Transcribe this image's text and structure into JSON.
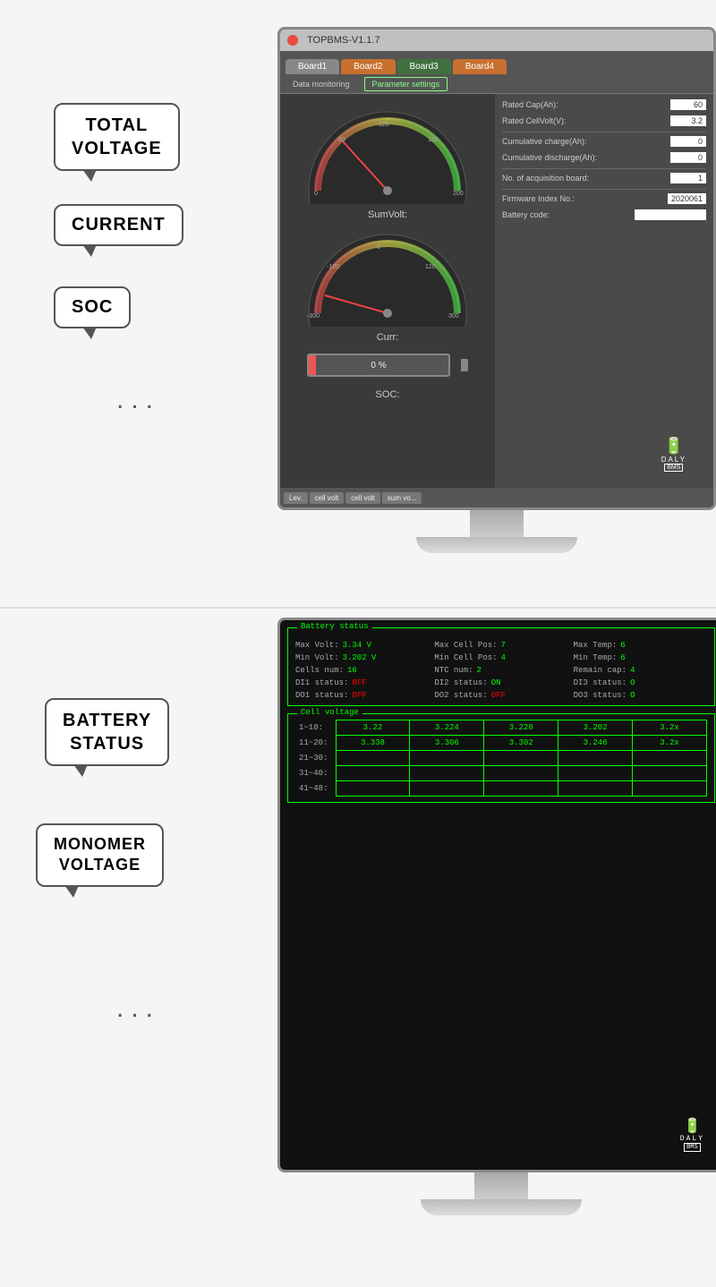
{
  "top_section": {
    "bubble_total_voltage": "TOTAL\nVOLTAGE",
    "bubble_current": "CURRENT",
    "bubble_soc": "SOC",
    "dots": "...",
    "monitor": {
      "title": "TOPBMS-V1.1.7",
      "tabs": [
        "Board1",
        "Board2",
        "Board3",
        "Board4"
      ],
      "subtabs": [
        "Data monitoring",
        "Parameter settings"
      ],
      "gauge1_label": "SumVolt:",
      "gauge2_label": "Curr:",
      "soc_label": "SOC:",
      "battery_percent": "0 %",
      "params": [
        {
          "label": "Rated Cap(Ah):",
          "value": "60"
        },
        {
          "label": "Rated CellVolt(V):",
          "value": "3.2"
        },
        {
          "label": "Cumulative charge(Ah):",
          "value": "0"
        },
        {
          "label": "Cumulative discharge(Ah):",
          "value": "0"
        },
        {
          "label": "No. of acquisition board:",
          "value": "1"
        },
        {
          "label": "Firmware Index No.:",
          "value": "2020061"
        },
        {
          "label": "Battery code:",
          "value": ""
        }
      ],
      "bottom_tabs": [
        "Lev.",
        "cell volt",
        "cell volt",
        "sum vo..."
      ]
    }
  },
  "bottom_section": {
    "bubble_battery_status": "BATTERY\nSTATUS",
    "bubble_monomer_voltage": "MONOMER\nVOLTAGE",
    "dots": "...",
    "monitor": {
      "battery_status": {
        "title": "Battery status",
        "max_volt_label": "Max Volt:",
        "max_volt_val": "3.34 V",
        "max_cell_pos_label": "Max Cell Pos:",
        "max_cell_pos_val": "7",
        "max_temp_label": "Max Temp:",
        "max_temp_val": "6",
        "min_volt_label": "Min Volt:",
        "min_volt_val": "3.202 V",
        "min_cell_pos_label": "Min Cell Pos:",
        "min_cell_pos_val": "4",
        "min_temp_label": "Min Temp:",
        "min_temp_val": "6",
        "cells_num_label": "Cells num:",
        "cells_num_val": "16",
        "ntc_num_label": "NTC num:",
        "ntc_num_val": "2",
        "remain_cap_label": "Remain cap:",
        "remain_cap_val": "4",
        "di1_label": "DI1 status:",
        "di1_val": "OFF",
        "di2_label": "DI2 status:",
        "di2_val": "ON",
        "di3_label": "DI3 status:",
        "di3_val": "O",
        "do1_label": "DO1 status:",
        "do1_val": "OFF",
        "do2_label": "DO2 status:",
        "do2_val": "OFF",
        "do3_label": "DO3 status:",
        "do3_val": "O"
      },
      "cell_voltage": {
        "title": "Cell voltage",
        "row1_label": "1~10:",
        "row1_vals": [
          "3.22",
          "3.224",
          "3.228",
          "3.202",
          "3.2x"
        ],
        "row2_label": "11~20:",
        "row2_vals": [
          "3.338",
          "3.306",
          "3.302",
          "3.246",
          "3.2x"
        ],
        "row3_label": "21~30:",
        "row3_vals": [
          "",
          "",
          "",
          "",
          ""
        ],
        "row4_label": "31~40:",
        "row4_vals": [
          "",
          "",
          "",
          "",
          ""
        ],
        "row5_label": "41~48:",
        "row5_vals": [
          "",
          "",
          "",
          "",
          ""
        ]
      }
    }
  }
}
